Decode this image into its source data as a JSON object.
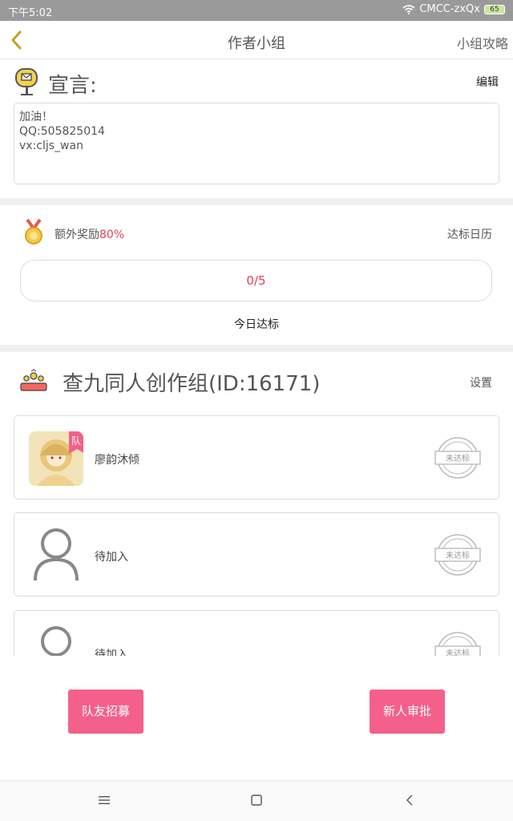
{
  "status_bar": {
    "time": "下午5:02",
    "carrier": "CMCC-zxQx",
    "battery": "65"
  },
  "nav": {
    "title": "作者小组",
    "right_link": "小组攻略"
  },
  "declaration": {
    "title": "宣言:",
    "edit_label": "编辑",
    "text": "加油！\nQQ:505825014\nvx:cljs_wan"
  },
  "reward": {
    "label": "额外奖励",
    "percent": "80%",
    "calendar_link": "达标日历"
  },
  "progress": {
    "value": "0/5",
    "today_label": "今日达标"
  },
  "group": {
    "name": "查九同人创作组(ID:16171)",
    "settings_label": "设置"
  },
  "members": [
    {
      "name": "廖韵沐倾",
      "badge": "队",
      "status": "未达标",
      "has_avatar": true
    },
    {
      "name": "待加入",
      "status": "未达标",
      "has_avatar": false
    },
    {
      "name": "待加入",
      "status": "未达标",
      "has_avatar": false
    }
  ],
  "buttons": {
    "recruit": "队友招募",
    "approve": "新人审批"
  },
  "colors": {
    "accent_pink": "#f4608a",
    "accent_red": "#e0405a",
    "back_yellow": "#c8a020"
  }
}
